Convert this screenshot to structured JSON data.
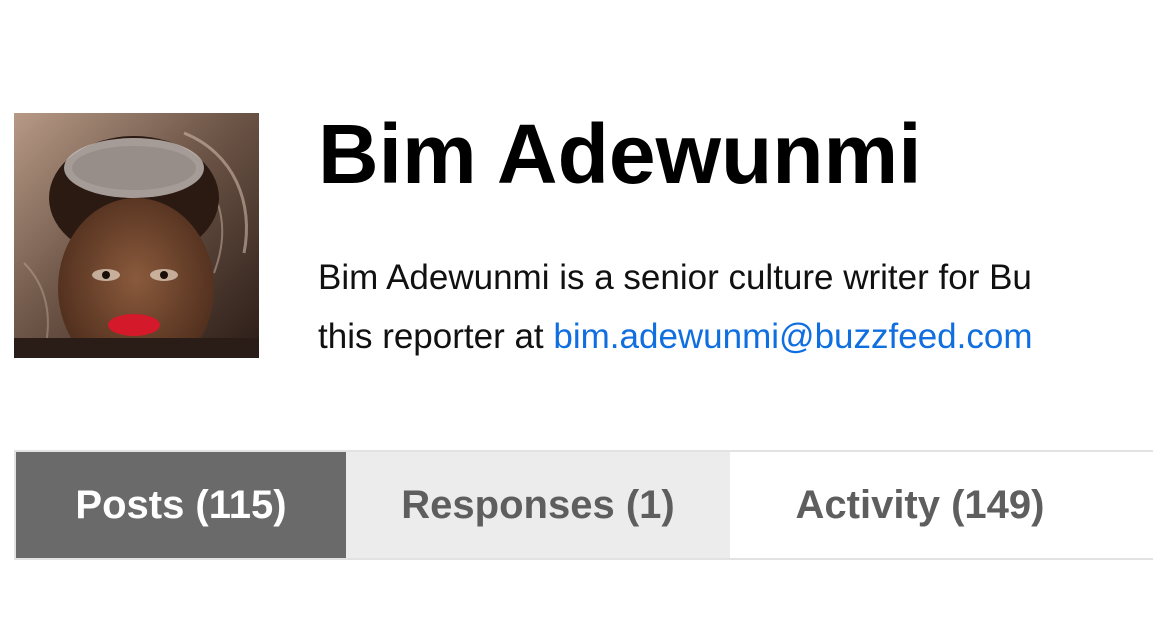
{
  "profile": {
    "name": "Bim Adewunmi",
    "bio_line1": "Bim Adewunmi is a senior culture writer for Bu",
    "bio_line2_prefix": "this reporter at ",
    "email": "bim.adewunmi@buzzfeed.com",
    "avatar_alt": "avatar-photo"
  },
  "tabs": [
    {
      "label": "Posts (115)",
      "active": true
    },
    {
      "label": "Responses (1)",
      "active": false
    },
    {
      "label": "Activity (149)",
      "active": false
    }
  ],
  "colors": {
    "link": "#0f6ee0",
    "active_tab_bg": "#6a6a6a",
    "inactive_tab_text": "#5e5e5e"
  }
}
